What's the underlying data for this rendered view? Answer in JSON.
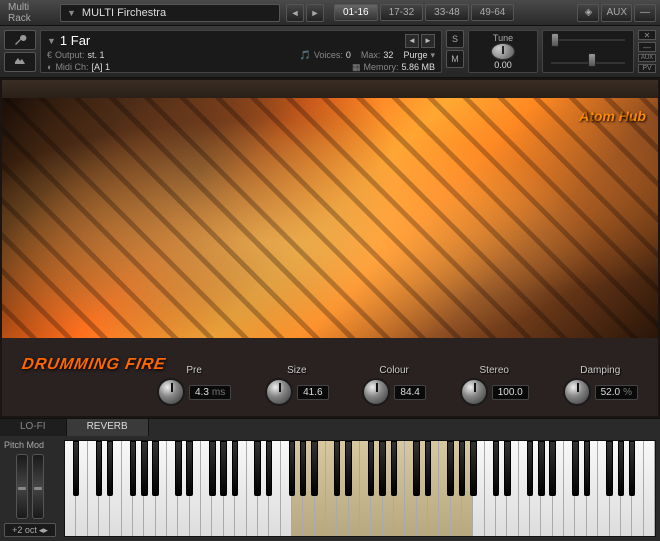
{
  "header": {
    "multi_rack_label": "Multi\nRack",
    "multi_title": "MULTI Firchestra",
    "page_tabs": [
      "01-16",
      "17-32",
      "33-48",
      "49-64"
    ],
    "active_page": 0,
    "aux_label": "AUX"
  },
  "instrument": {
    "name": "1 Far",
    "output_label": "Output:",
    "output_value": "st. 1",
    "midi_label": "Midi Ch:",
    "midi_value": "[A] 1",
    "voices_label": "Voices:",
    "voices_value": "0",
    "max_label": "Max:",
    "max_value": "32",
    "purge_label": "Purge",
    "memory_label": "Memory:",
    "memory_value": "5.86 MB",
    "solo_label": "S",
    "mute_label": "M",
    "tune_label": "Tune",
    "tune_value": "0.00",
    "aux_label": "AUX",
    "pv_label": "PV"
  },
  "main": {
    "logo_text": "Atom Hub",
    "product_name": "DRUMMING FIRE",
    "knobs": [
      {
        "label": "Pre",
        "value": "4.3",
        "unit": "ms"
      },
      {
        "label": "Size",
        "value": "41.6",
        "unit": ""
      },
      {
        "label": "Colour",
        "value": "84.4",
        "unit": ""
      },
      {
        "label": "Stereo",
        "value": "100.0",
        "unit": ""
      },
      {
        "label": "Damping",
        "value": "52.0",
        "unit": "%"
      }
    ]
  },
  "tabs": {
    "items": [
      "LO-FI",
      "REVERB"
    ],
    "active": 1
  },
  "keyboard": {
    "pitch_mod_label": "Pitch Mod",
    "octave_label": "+2 oct"
  }
}
